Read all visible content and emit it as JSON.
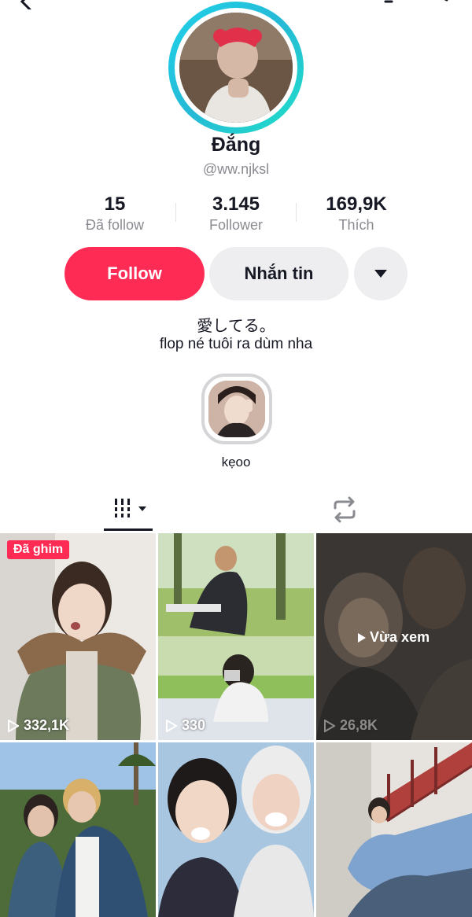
{
  "profile": {
    "name": "Đắng",
    "handle": "@ww.njksl"
  },
  "stats": [
    {
      "value": "15",
      "label": "Đã follow"
    },
    {
      "value": "3.145",
      "label": "Follower"
    },
    {
      "value": "169,9K",
      "label": "Thích"
    }
  ],
  "actions": {
    "follow_label": "Follow",
    "message_label": "Nhắn tin"
  },
  "bio": {
    "line1": "愛してる。",
    "line2": "flop né tuôi ra dùm nha"
  },
  "highlight": {
    "label": "kẹoo"
  },
  "grid": [
    {
      "views": "332,1K",
      "badge": "Đã ghim"
    },
    {
      "views": "330"
    },
    {
      "views": "26,8K",
      "overlay": "Vừa xem"
    },
    {},
    {},
    {}
  ],
  "colors": {
    "accent": "#fe2c55",
    "avatar_ring": "#1fd2e8"
  }
}
